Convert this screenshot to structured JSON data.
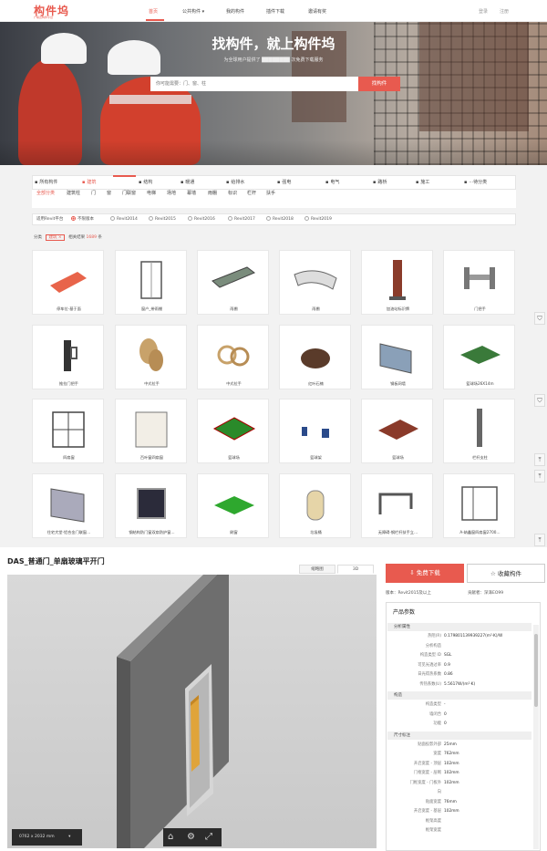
{
  "brand": {
    "logo": "构件坞",
    "tagline": "广联达构件平台"
  },
  "nav": {
    "items": [
      "首页",
      "公共构件",
      "我的构件",
      "插件下载",
      "邀请有奖"
    ],
    "login": "登录",
    "register": "注册"
  },
  "hero": {
    "title": "找构件，就上构件坞",
    "subtitle": "为全球用户提供了 ████████ 次免费下载服务",
    "search_placeholder": "你可能需要：门、窗、柱",
    "search_button": "找构件"
  },
  "categories": [
    "所有构件",
    "建筑",
    "结构",
    "暖通",
    "给排水",
    "强电",
    "电气",
    "路桥",
    "施工",
    "···待分类"
  ],
  "subcategories": [
    "全部分类",
    "建筑柱",
    "门",
    "窗",
    "门联窗",
    "电梯",
    "场地",
    "幕墙",
    "雨棚",
    "标识",
    "栏杆",
    "扶手"
  ],
  "revit": {
    "label": "适用Revit平台",
    "options": [
      "不限版本",
      "Revit2014",
      "Revit2015",
      "Revit2016",
      "Revit2017",
      "Revit2018",
      "Revit2019"
    ]
  },
  "filter": {
    "label": "分类",
    "tag": "建筑",
    "results_label": "相关结果",
    "count": "1689",
    "unit": "条"
  },
  "grid": [
    [
      "停车位-基于面",
      "窗户_带雨棚",
      "雨棚",
      "雨棚",
      "加油站标识牌",
      "门把手"
    ],
    [
      "推拉门把手",
      "中式拉手",
      "中式拉手",
      "红叶石楠",
      "钢板网墙",
      "篮球场26X14m"
    ],
    [
      "四扇窗",
      "百叶窗四扇窗",
      "篮球场",
      "篮球架",
      "篮球场",
      "栏杆支柱"
    ],
    [
      "住宅大堂-铝合金门联窗…",
      "钢结构防门窗双扇防护窗…",
      "刷窗",
      "垃圾桶",
      "无障碍-钢栏杆扶手立…",
      "A-纳鑫窗四扇窗2700…"
    ]
  ],
  "detail": {
    "title": "DAS_普通门_单扇玻璃平开门",
    "tabs": [
      "缩略图",
      "3D"
    ],
    "dimensions": "0762 x 2032 mm",
    "download": "免费下载",
    "favorite": "收藏构件",
    "version_label": "版本：",
    "version": "Revit2015及以上",
    "contributor_label": "贡献者：",
    "contributor": "深泽EO99"
  },
  "params": {
    "title": "产品参数",
    "sections": [
      {
        "name": "分析属性",
        "rows": [
          [
            "热阻(R)",
            "0.179801139939227(m²·K)/W"
          ],
          [
            "分析构造",
            ""
          ],
          [
            "构造类型 ID",
            "SGL"
          ],
          [
            "可见光透过率",
            "0.9"
          ],
          [
            "日光得热系数",
            "0.86"
          ],
          [
            "传热系数(U)",
            "5.5617W/(m²·K)"
          ]
        ]
      },
      {
        "name": "构造",
        "rows": [
          [
            "构造类型",
            "-"
          ],
          [
            "墙闭合",
            "0"
          ],
          [
            "功能",
            "0"
          ]
        ]
      },
      {
        "name": "尺寸标注",
        "rows": [
          [
            "贴面投影外部",
            "25mm"
          ],
          [
            "宽度",
            "762mm"
          ],
          [
            "开启宽度 - 顶层",
            "102mm"
          ],
          [
            "门框宽度 - 层砌",
            "102mm"
          ],
          [
            "门框宽度 - 门板外",
            "102mm"
          ],
          [
            "向",
            ""
          ],
          [
            "贴面宽度",
            "76mm"
          ],
          [
            "开启宽度 - 基层",
            "102mm"
          ],
          [
            "框架高度",
            ""
          ],
          [
            "框架宽度",
            ""
          ]
        ]
      }
    ]
  }
}
